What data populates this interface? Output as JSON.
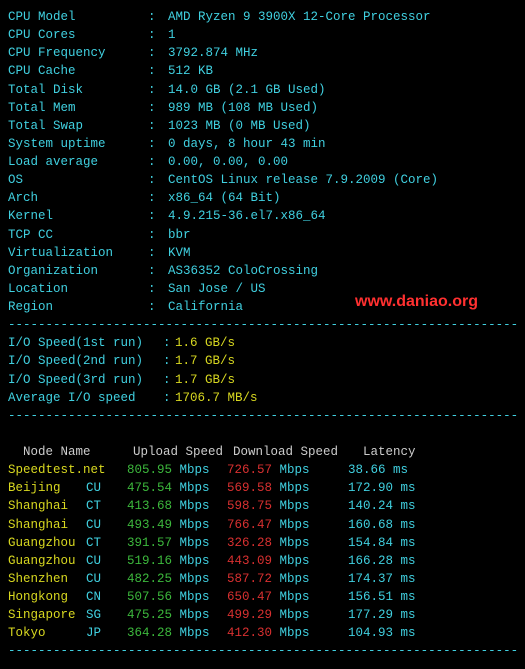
{
  "separator": "---------------------------------------------------------------------",
  "watermark": "www.daniao.org",
  "sysinfo": [
    {
      "label": "CPU Model",
      "value": "AMD Ryzen 9 3900X 12-Core Processor"
    },
    {
      "label": "CPU Cores",
      "value": "1"
    },
    {
      "label": "CPU Frequency",
      "value": "3792.874 MHz"
    },
    {
      "label": "CPU Cache",
      "value": "512 KB"
    },
    {
      "label": "Total Disk",
      "value": "14.0 GB (2.1 GB Used)"
    },
    {
      "label": "Total Mem",
      "value": "989 MB (108 MB Used)"
    },
    {
      "label": "Total Swap",
      "value": "1023 MB (0 MB Used)"
    },
    {
      "label": "System uptime",
      "value": "0 days, 8 hour 43 min"
    },
    {
      "label": "Load average",
      "value": "0.00, 0.00, 0.00"
    },
    {
      "label": "OS",
      "value": "CentOS Linux release 7.9.2009 (Core)"
    },
    {
      "label": "Arch",
      "value": "x86_64 (64 Bit)"
    },
    {
      "label": "Kernel",
      "value": "4.9.215-36.el7.x86_64"
    },
    {
      "label": "TCP CC",
      "value": "bbr"
    },
    {
      "label": "Virtualization",
      "value": "KVM"
    },
    {
      "label": "Organization",
      "value": "AS36352 ColoCrossing"
    },
    {
      "label": "Location",
      "value": "San Jose / US"
    },
    {
      "label": "Region",
      "value": "California"
    }
  ],
  "io": [
    {
      "label": "I/O Speed(1st run)",
      "value": "1.6 GB/s"
    },
    {
      "label": "I/O Speed(2nd run)",
      "value": "1.7 GB/s"
    },
    {
      "label": "I/O Speed(3rd run)",
      "value": "1.7 GB/s"
    },
    {
      "label": "Average I/O speed",
      "value": "1706.7 MB/s"
    }
  ],
  "table_header": {
    "node": "Node Name",
    "up": "Upload Speed",
    "dl": "Download Speed",
    "lat": "Latency"
  },
  "unit": "Mbps",
  "speedtest": [
    {
      "name": "Speedtest.net",
      "loc": "",
      "up": "805.95",
      "dl": "726.57",
      "lat": "38.66 ms"
    },
    {
      "name": "Beijing",
      "loc": "CU",
      "up": "475.54",
      "dl": "569.58",
      "lat": "172.90 ms"
    },
    {
      "name": "Shanghai",
      "loc": "CT",
      "up": "413.68",
      "dl": "598.75",
      "lat": "140.24 ms"
    },
    {
      "name": "Shanghai",
      "loc": "CU",
      "up": "493.49",
      "dl": "766.47",
      "lat": "160.68 ms"
    },
    {
      "name": "Guangzhou",
      "loc": "CT",
      "up": "391.57",
      "dl": "326.28",
      "lat": "154.84 ms"
    },
    {
      "name": "Guangzhou",
      "loc": "CU",
      "up": "519.16",
      "dl": "443.09",
      "lat": "166.28 ms"
    },
    {
      "name": "Shenzhen",
      "loc": "CU",
      "up": "482.25",
      "dl": "587.72",
      "lat": "174.37 ms"
    },
    {
      "name": "Hongkong",
      "loc": "CN",
      "up": "507.56",
      "dl": "650.47",
      "lat": "156.51 ms"
    },
    {
      "name": "Singapore",
      "loc": "SG",
      "up": "475.25",
      "dl": "499.29",
      "lat": "177.29 ms"
    },
    {
      "name": "Tokyo",
      "loc": "JP",
      "up": "364.28",
      "dl": "412.30",
      "lat": "104.93 ms"
    }
  ]
}
